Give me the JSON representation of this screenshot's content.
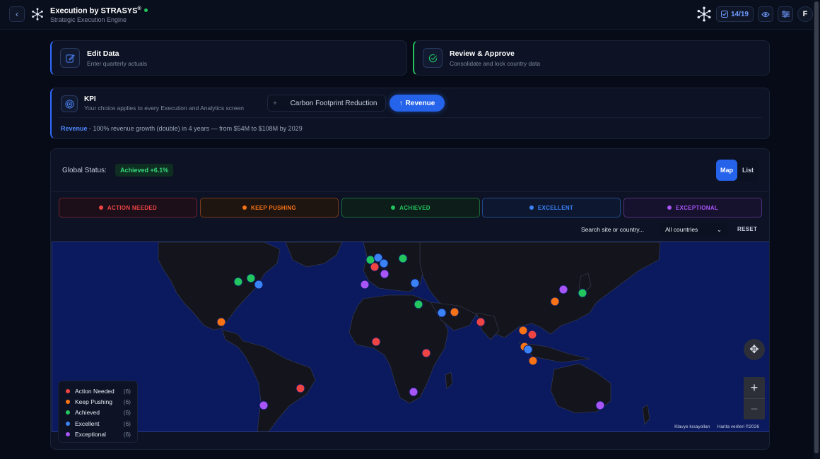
{
  "header": {
    "title": "Execution by STRASYS",
    "title_mark": "®",
    "subtitle": "Strategic Execution Engine",
    "progress": "14/19",
    "avatar": "F"
  },
  "actions": [
    {
      "title": "Edit Data",
      "desc": "Enter quarterly actuals",
      "icon": "pencil-icon",
      "color": "#2f6bff"
    },
    {
      "title": "Review & Approve",
      "desc": "Consolidate and lock country data",
      "icon": "check-circle-icon",
      "color": "#22c55e"
    }
  ],
  "kpi": {
    "title": "KPI",
    "subtitle": "Your choice applies to every Execution and Analytics screen",
    "option": "Carbon Footprint Reduction",
    "option_prefix": "+",
    "active": "Revenue",
    "active_prefix": "↑",
    "desc_name": "Revenue",
    "desc_text": " - 100% revenue growth (double) in 4 years — from $54M to $108M by 2029"
  },
  "status": {
    "label": "Global Status:",
    "badge": "Achieved +6.1%",
    "views": [
      "Map",
      "List"
    ],
    "active_view": "Map"
  },
  "filters": [
    {
      "label": "ACTION NEEDED",
      "color": "#ef4444"
    },
    {
      "label": "KEEP PUSHING",
      "color": "#f97316"
    },
    {
      "label": "ACHIEVED",
      "color": "#22c55e"
    },
    {
      "label": "EXCELLENT",
      "color": "#3b82f6"
    },
    {
      "label": "EXCEPTIONAL",
      "color": "#a855f7"
    }
  ],
  "search": {
    "placeholder": "Search site or country...",
    "country": "All countries",
    "reset": "RESET"
  },
  "legend": [
    {
      "label": "Action Needed",
      "count": "(6)",
      "color": "#ef4444"
    },
    {
      "label": "Keep Pushing",
      "count": "(6)",
      "color": "#f97316"
    },
    {
      "label": "Achieved",
      "count": "(6)",
      "color": "#22c55e"
    },
    {
      "label": "Excellent",
      "count": "(6)",
      "color": "#3b82f6"
    },
    {
      "label": "Exceptional",
      "count": "(6)",
      "color": "#a855f7"
    }
  ],
  "map_credit": [
    "Klavye kısayolları",
    "Harita verileri ©2026"
  ]
}
